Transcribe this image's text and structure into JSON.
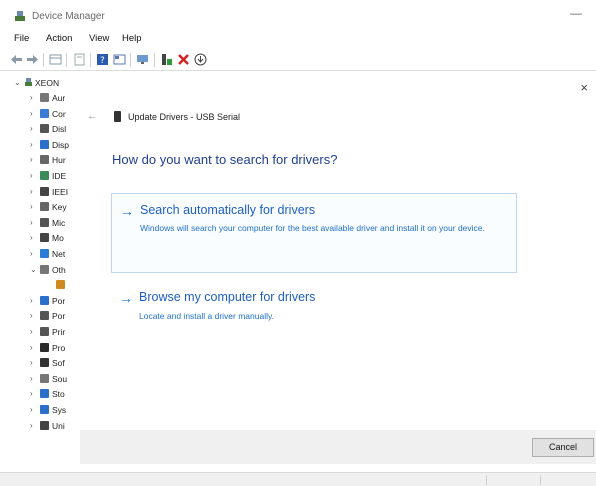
{
  "window": {
    "title": "Device Manager",
    "minimize_glyph": "—"
  },
  "menu": {
    "items": [
      "File",
      "Action",
      "View",
      "Help"
    ]
  },
  "toolbar": {
    "icons": [
      "back-arrow-icon",
      "forward-arrow-icon",
      "properties-grid-icon",
      "console-icon",
      "help-icon",
      "view-grid-icon",
      "monitor-icon",
      "update-driver-icon",
      "uninstall-x-icon",
      "scan-hardware-icon"
    ]
  },
  "tree": {
    "root_label": "XEON",
    "items": [
      {
        "label": "Aur",
        "icon": "audio-icon",
        "color": "#777777",
        "expanded": false
      },
      {
        "label": "Cor",
        "icon": "computer-icon",
        "color": "#3a7bd5",
        "expanded": false
      },
      {
        "label": "Disl",
        "icon": "disk-icon",
        "color": "#555555",
        "expanded": false
      },
      {
        "label": "Disp",
        "icon": "display-icon",
        "color": "#2a6fc9",
        "expanded": false
      },
      {
        "label": "Hur",
        "icon": "hid-icon",
        "color": "#666666",
        "expanded": false
      },
      {
        "label": "IDE",
        "icon": "ide-icon",
        "color": "#3a8a5a",
        "expanded": false
      },
      {
        "label": "IEEI",
        "icon": "ieee-icon",
        "color": "#444444",
        "expanded": false
      },
      {
        "label": "Key",
        "icon": "keyboard-icon",
        "color": "#666666",
        "expanded": false
      },
      {
        "label": "Mic",
        "icon": "mic-icon",
        "color": "#555555",
        "expanded": false
      },
      {
        "label": "Mo",
        "icon": "mouse-icon",
        "color": "#444444",
        "expanded": false
      },
      {
        "label": "Net",
        "icon": "network-icon",
        "color": "#2a7bd5",
        "expanded": false
      },
      {
        "label": "Oth",
        "icon": "other-devices-icon",
        "color": "#777777",
        "expanded": true
      },
      {
        "label": "",
        "icon": "warning-device-icon",
        "color": "#d08a20",
        "expanded": null,
        "child": true
      },
      {
        "label": "Por",
        "icon": "port-icon",
        "color": "#2a6fc9",
        "expanded": false
      },
      {
        "label": "Por",
        "icon": "port-icon",
        "color": "#555555",
        "expanded": false
      },
      {
        "label": "Prir",
        "icon": "printer-icon",
        "color": "#555555",
        "expanded": false
      },
      {
        "label": "Pro",
        "icon": "processor-icon",
        "color": "#2a2a2a",
        "expanded": false
      },
      {
        "label": "Sof",
        "icon": "software-icon",
        "color": "#333333",
        "expanded": false
      },
      {
        "label": "Sou",
        "icon": "sound-icon",
        "color": "#777777",
        "expanded": false
      },
      {
        "label": "Sto",
        "icon": "storage-icon",
        "color": "#2a6fc9",
        "expanded": false
      },
      {
        "label": "Sys",
        "icon": "system-icon",
        "color": "#2a6fc9",
        "expanded": false
      },
      {
        "label": "Uni",
        "icon": "usb-icon",
        "color": "#444444",
        "expanded": false
      }
    ]
  },
  "dialog": {
    "close_glyph": "×",
    "back_glyph": "←",
    "title": "Update Drivers - USB Serial",
    "question": "How do you want to search for drivers?",
    "option1": {
      "title": "Search automatically for drivers",
      "description": "Windows will search your computer for the best available driver and install it on your device."
    },
    "option2": {
      "title": "Browse my computer for drivers",
      "description": "Locate and install a driver manually."
    },
    "cancel_label": "Cancel",
    "arrow_glyph": "→"
  }
}
